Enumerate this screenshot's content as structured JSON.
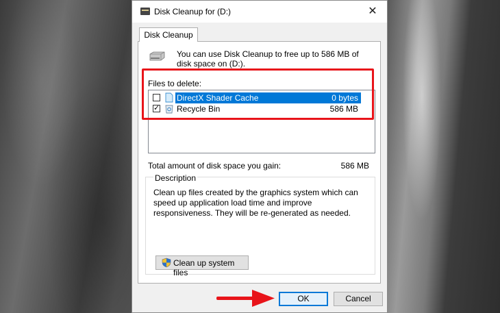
{
  "window": {
    "title": "Disk Cleanup for  (D:)",
    "close_glyph": "✕"
  },
  "tab": {
    "label": "Disk Cleanup"
  },
  "intro": {
    "text": "You can use Disk Cleanup to free up to 586 MB of disk space on  (D:).",
    "icon": "drive-icon"
  },
  "files": {
    "label": "Files to delete:",
    "items": [
      {
        "name": "DirectX Shader Cache",
        "size": "0 bytes",
        "checked": false,
        "selected": true,
        "icon": "file-icon"
      },
      {
        "name": "Recycle Bin",
        "size": "586 MB",
        "checked": true,
        "selected": false,
        "icon": "recycle-bin-icon"
      }
    ]
  },
  "total": {
    "label": "Total amount of disk space you gain:",
    "value": "586 MB"
  },
  "description": {
    "legend": "Description",
    "text": "Clean up files created by the graphics system which can speed up application load time and improve responsiveness. They will be re-generated as needed."
  },
  "cleanup_button": {
    "label": "Clean up system files",
    "icon": "shield-icon"
  },
  "buttons": {
    "ok": "OK",
    "cancel": "Cancel"
  },
  "annotations": {
    "highlight_color": "#e8141a",
    "arrow_color": "#e8141a"
  },
  "colors": {
    "selection": "#0078d7"
  }
}
